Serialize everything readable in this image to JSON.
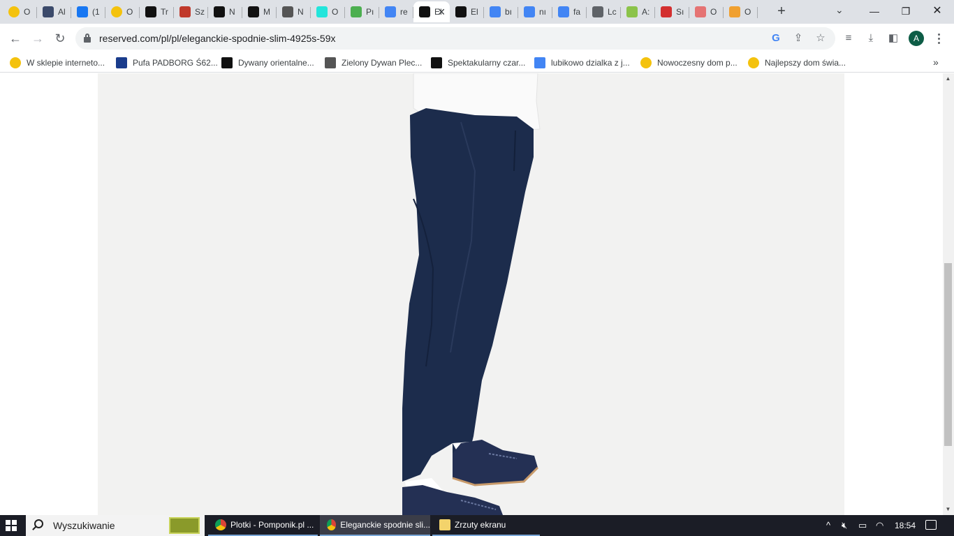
{
  "tabs": [
    {
      "label": "O",
      "icon": "yellow-circle-icon",
      "color": "#f4c20d"
    },
    {
      "label": "Al",
      "icon": "sloth-icon",
      "color": "#3b4a6b"
    },
    {
      "label": "(1",
      "icon": "facebook-icon",
      "color": "#1877f2"
    },
    {
      "label": "O",
      "icon": "yellow-circle-icon",
      "color": "#f4c20d"
    },
    {
      "label": "Tr",
      "icon": "f-icon",
      "color": "#111111"
    },
    {
      "label": "Sz",
      "icon": "crown-icon",
      "color": "#c0392b"
    },
    {
      "label": "N",
      "icon": "p-icon",
      "color": "#111111"
    },
    {
      "label": "M",
      "icon": "p-icon",
      "color": "#111111"
    },
    {
      "label": "N",
      "icon": "m-icon",
      "color": "#555555"
    },
    {
      "label": "O",
      "icon": "olx-icon",
      "color": "#23e5db"
    },
    {
      "label": "Pı",
      "icon": "grid-icon",
      "color": "#4caf50"
    },
    {
      "label": "re",
      "icon": "google-icon",
      "color": "#4285f4"
    },
    {
      "label": "El",
      "icon": "reserved-icon",
      "color": "#111111",
      "active": true
    },
    {
      "label": "El",
      "icon": "reserved-icon",
      "color": "#111111"
    },
    {
      "label": "bı",
      "icon": "google-icon",
      "color": "#4285f4"
    },
    {
      "label": "nı",
      "icon": "google-icon",
      "color": "#4285f4"
    },
    {
      "label": "fa",
      "icon": "google-icon",
      "color": "#4285f4"
    },
    {
      "label": "Lc",
      "icon": "globe-icon",
      "color": "#5f6368"
    },
    {
      "label": "A:",
      "icon": "leaf-icon",
      "color": "#8bc34a"
    },
    {
      "label": "Sı",
      "icon": "star-burst-icon",
      "color": "#d32f2f"
    },
    {
      "label": "O",
      "icon": "r-icon",
      "color": "#e57373"
    },
    {
      "label": "O",
      "icon": "h-icon",
      "color": "#f0a030"
    }
  ],
  "address_bar": {
    "url": "reserved.com/pl/pl/eleganckie-spodnie-slim-4925s-59x"
  },
  "bookmarks": [
    {
      "label": "W sklepie interneto...",
      "icon": "yellow-circle-icon",
      "color": "#f4c20d"
    },
    {
      "label": "Pufa PADBORG Ś62...",
      "icon": "jysk-icon",
      "color": "#1a3c8c"
    },
    {
      "label": "Dywany orientalne...",
      "icon": "r-icon",
      "color": "#111111"
    },
    {
      "label": "Zielony Dywan Plec...",
      "icon": "c-icon",
      "color": "#555555"
    },
    {
      "label": "Spektakularny czar...",
      "icon": "s-icon",
      "color": "#111111"
    },
    {
      "label": "lubikowo dzialka z j...",
      "icon": "google-icon",
      "color": "#4285f4"
    },
    {
      "label": "Nowoczesny dom p...",
      "icon": "yellow-circle-icon",
      "color": "#f4c20d"
    },
    {
      "label": "Najlepszy dom świa...",
      "icon": "yellow-circle-icon",
      "color": "#f4c20d"
    }
  ],
  "taskbar": {
    "search_label": "Wyszukiwanie",
    "items": [
      {
        "label": "Plotki - Pomponik.pl ...",
        "icon": "chrome-icon"
      },
      {
        "label": "Eleganckie spodnie sli...",
        "icon": "chrome-icon"
      },
      {
        "label": "Zrzuty ekranu",
        "icon": "folder-icon"
      }
    ],
    "time": "18:54"
  },
  "colors": {
    "chrome_frame": "#dee1e6",
    "taskbar": "#1b1d26",
    "photo_background": "#f2f2f1",
    "trousers": "#1c2c4c",
    "profile_avatar": "#0d5c46"
  },
  "profile": {
    "initial": "A"
  }
}
